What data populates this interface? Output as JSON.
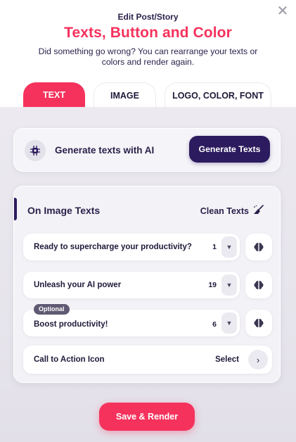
{
  "header": {
    "close_icon": "close-icon",
    "kicker": "Edit Post/Story",
    "title": "Texts, Button and Color",
    "subtitle": "Did something go wrong? You can rearrange your texts or colors and render again."
  },
  "tabs": [
    {
      "label": "TEXT",
      "active": true
    },
    {
      "label": "IMAGE",
      "active": false
    },
    {
      "label": "LOGO, COLOR, FONT",
      "active": false
    }
  ],
  "ai": {
    "icon": "ai-chip-icon",
    "label": "Generate texts with AI",
    "button": "Generate Texts"
  },
  "texts_panel": {
    "title": "On Image Texts",
    "clean_label": "Clean Texts",
    "clean_icon": "broom-icon",
    "rows": [
      {
        "text": "Ready to supercharge your productivity?",
        "count": "1",
        "badge": ""
      },
      {
        "text": "Unleash your AI power",
        "count": "19",
        "badge": ""
      },
      {
        "text": "Boost productivity!",
        "count": "6",
        "badge": "Optional"
      }
    ],
    "cta": {
      "label": "Call to Action Icon",
      "select": "Select"
    }
  },
  "footer": {
    "save_label": "Save & Render"
  },
  "colors": {
    "accent": "#f5325c",
    "primary_dark": "#2c1b5e"
  }
}
